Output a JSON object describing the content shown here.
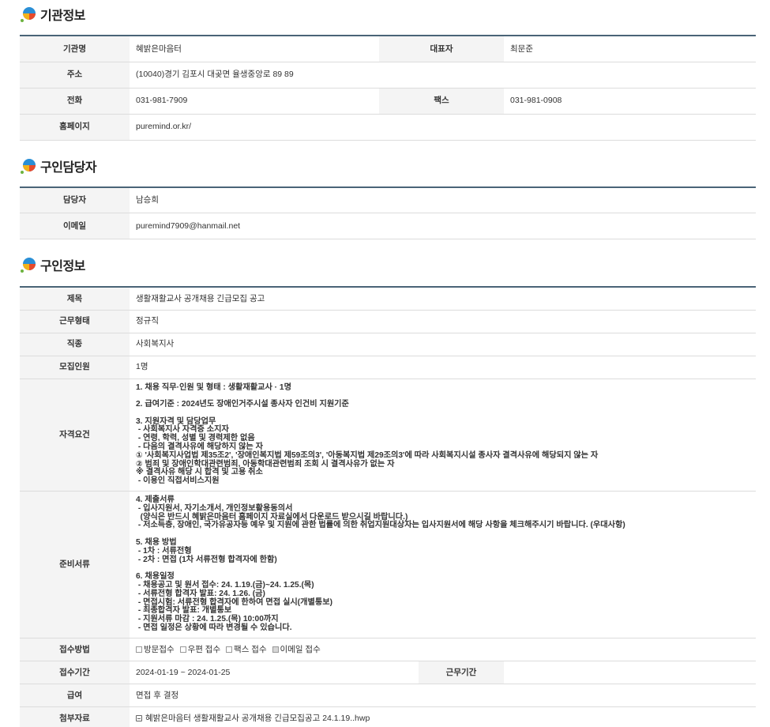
{
  "org_section": {
    "title": "기관정보",
    "rows": {
      "name_label": "기관명",
      "name_value": "혜밝은마음터",
      "rep_label": "대표자",
      "rep_value": "최문준",
      "addr_label": "주소",
      "addr_value": "(10040)경기 김포시 대곶면 율생중앙로 89 89",
      "tel_label": "전화",
      "tel_value": "031-981-7909",
      "fax_label": "팩스",
      "fax_value": "031-981-0908",
      "home_label": "홈페이지",
      "home_value": "puremind.or.kr/"
    }
  },
  "contact_section": {
    "title": "구인담당자",
    "rows": {
      "person_label": "담당자",
      "person_value": "남승희",
      "email_label": "이메일",
      "email_value": "puremind7909@hanmail.net"
    }
  },
  "job_section": {
    "title": "구인정보",
    "rows": {
      "subject_label": "제목",
      "subject_value": "생활재활교사 공개채용 긴급모집 공고",
      "worktype_label": "근무형태",
      "worktype_value": "정규직",
      "jobtype_label": "직종",
      "jobtype_value": "사회복지사",
      "headcount_label": "모집인원",
      "headcount_value": "1명",
      "qual_label": "자격요건",
      "qual_value": "1. 채용 직무·인원 및 형태 : 생활재활교사 · 1명\n\n2. 급여기준 : 2024년도 장애인거주시설 종사자 인건비 지원기준\n\n3. 지원자격 및 담당업무\n - 사회복지사 자격증 소지자\n - 연령, 학력, 성별 및 경력제한 없음\n - 다음의 결격사유에 해당하지 않는 자\n① '사회복지사업법 제35조2', '장애인복지법 제59조의3', '아동복지법 제29조의3'에 따라 사회복지시설 종사자 결격사유에 해당되지 않는 자\n② 범죄 및 장애인학대관련범죄, 아동학대관련범죄 조회 시 결격사유가 없는 자\n※ 결격사유 해당 시 합격 및 고용 취소\n - 이용인 직접서비스지원",
      "docs_label": "준비서류",
      "docs_value": "4. 제출서류\n - 입사지원서, 자기소개서, 개인정보활용동의서\n  (양식은 반드시 혜밝은마음터 홈페이지 자료실에서 다운로드 받으시길 바랍니다.)\n - 저소득층, 장애인, 국가유공자등 예우 및 지원에 관한 법률에 의한 취업지원대상자는 입사지원서에 해당 사항을 체크해주시기 바랍니다. (우대사항)\n\n5. 채용 방법\n - 1차 : 서류전형\n - 2차 : 면접 (1차 서류전형 합격자에 한함)\n\n6. 채용일정\n - 채용공고 및 원서 접수: 24. 1.19.(금)~24. 1.25.(목)\n - 서류전형 합격자 발표: 24. 1.26. (금)\n - 면접시험: 서류전형 합격자에 한하여 면접 실시(개별통보)\n - 최종합격자 발표: 개별통보\n - 지원서류 마감 : 24. 1.25.(목) 10:00까지\n - 면접 일정은 상황에 따라 변경될 수 있습니다.",
      "method_label": "접수방법",
      "method_options": [
        "방문접수",
        "우편 접수",
        "팩스 접수",
        "이메일 접수"
      ],
      "period_label": "접수기간",
      "period_value": "2024-01-19 ~ 2024-01-25",
      "workperiod_label": "근무기간",
      "workperiod_value": "",
      "salary_label": "급여",
      "salary_value": "면접 후 결정",
      "attach_label": "첨부자료",
      "attach_value": "혜밝은마음터 생활재활교사 공개채용 긴급모집공고 24.1.19..hwp"
    }
  },
  "colors": {
    "header_bar": "#4a6477",
    "label_bg": "#f4f4f4",
    "row_border": "#dcdcdc"
  },
  "icons": {
    "section_icon": "colored-circle-icon",
    "file_icon": "file-icon"
  }
}
